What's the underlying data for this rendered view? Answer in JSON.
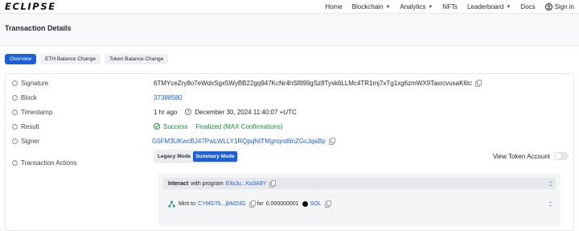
{
  "brand": {
    "logo": "ECLIPSE"
  },
  "nav": {
    "items": [
      {
        "label": "Home",
        "has_dropdown": false
      },
      {
        "label": "Blockchain",
        "has_dropdown": true
      },
      {
        "label": "Analytics",
        "has_dropdown": true
      },
      {
        "label": "NFTs",
        "has_dropdown": false
      },
      {
        "label": "Leaderboard",
        "has_dropdown": true
      },
      {
        "label": "Docs",
        "has_dropdown": false
      }
    ],
    "signin": "Sign in"
  },
  "page": {
    "title": "Transaction Details"
  },
  "tabs": [
    {
      "label": "Overview",
      "active": true
    },
    {
      "label": "ETH Balance Change",
      "active": false
    },
    {
      "label": "Token Balance Change",
      "active": false
    }
  ],
  "details": {
    "signature": {
      "label": "Signature",
      "value": "6TMYceZry8o7eWdxSgx5WyBB22gq947KcNr4hSf899gSz8Tyxk6LLMc4TR1mj7xTg1xg6zmWX9TaxrcvusaK6tc"
    },
    "block": {
      "label": "Block",
      "value": "37388580"
    },
    "timestamp": {
      "label": "Timestamp",
      "relative": "1 hr ago",
      "absolute": "December 30, 2024 11:40:07 +UTC"
    },
    "result": {
      "label": "Result",
      "status": "Success",
      "finality": "Finalized (MAX Confirmations)"
    },
    "signer": {
      "label": "Signer",
      "value": "G5FM3UKwcBJ47PwLWLLY1RQpqNtTMgnqnd6nZGcJqaBp"
    },
    "actions": {
      "label": "Transaction Actions"
    }
  },
  "actions_panel": {
    "modes": [
      "Legacy Mode",
      "Summary Mode"
    ],
    "active_mode": "Summary Mode",
    "toggle_label": "View Token Account",
    "interact": {
      "prefix": "Interact",
      "text": "with program",
      "program": "EitxJu...Ko3A9Y"
    },
    "mint": {
      "prefix": "Mint to",
      "recipient": "CYMGTk...jbMZdG",
      "for_text": "for",
      "amount": "0.000000001",
      "token": "SOL"
    }
  },
  "colors": {
    "accent": "#1d5fd6",
    "success": "#1b8a3a"
  }
}
